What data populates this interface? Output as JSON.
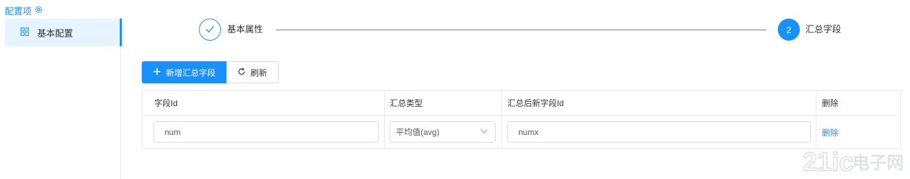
{
  "sidebar": {
    "title": "配置项",
    "title_icon": "gear-icon",
    "items": [
      {
        "label": "基本配置",
        "icon": "grid-icon",
        "active": true
      }
    ]
  },
  "steps": [
    {
      "index": "1",
      "label": "基本属性",
      "status": "finished",
      "icon": "check-icon"
    },
    {
      "index": "2",
      "label": "汇总字段",
      "status": "current"
    }
  ],
  "toolbar": {
    "add_label": "新增汇总字段",
    "add_icon": "plus-icon",
    "refresh_label": "刷新",
    "refresh_icon": "refresh-icon"
  },
  "table": {
    "columns": [
      "字段Id",
      "汇总类型",
      "汇总后新字段Id",
      "删除"
    ],
    "rows": [
      {
        "field_id": "num",
        "agg_type": "平均值(avg)",
        "new_field_id": "numx",
        "action": "删除"
      }
    ]
  },
  "watermark": {
    "text": "21ic电子网"
  },
  "colors": {
    "accent": "#1890ff",
    "active_bg": "#e6f4ff",
    "border": "#e8e8e8"
  }
}
